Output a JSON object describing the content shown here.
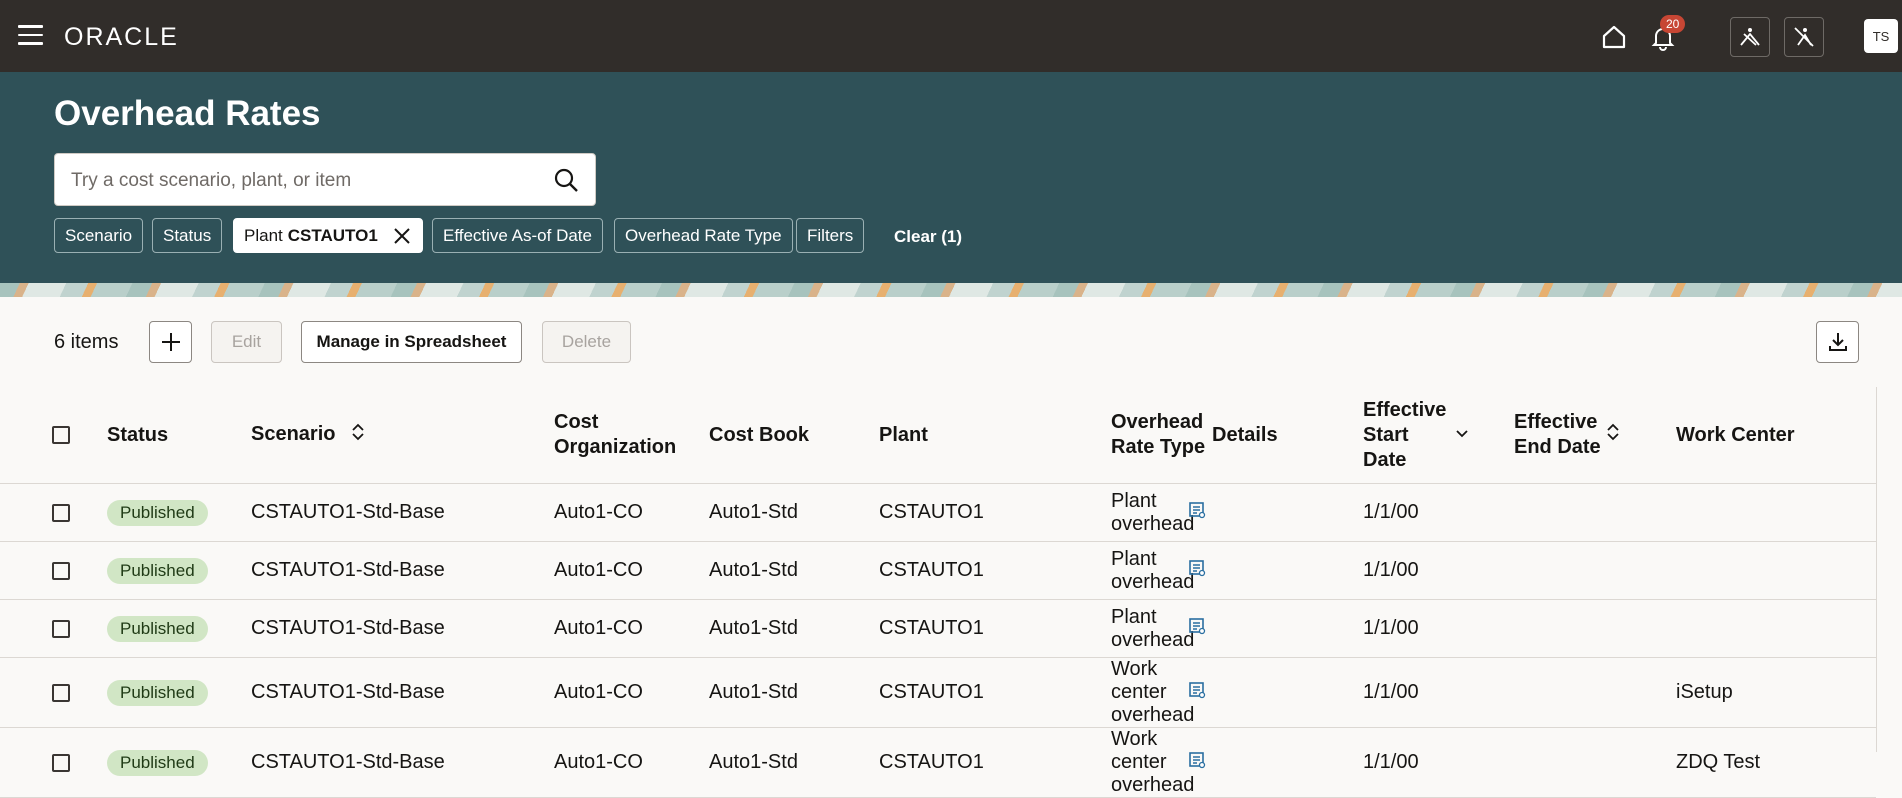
{
  "app": {
    "logo": "ORACLE",
    "notification_count": "20",
    "user_initials": "TS"
  },
  "page": {
    "title": "Overhead Rates"
  },
  "search": {
    "placeholder": "Try a cost scenario, plant, or item"
  },
  "filters": {
    "chips": [
      "Scenario",
      "Status",
      "Effective As-of Date",
      "Overhead Rate Type",
      "Filters"
    ],
    "plant_label": "Plant",
    "plant_value": "CSTAUTO1",
    "clear_label": "Clear (1)"
  },
  "toolbar": {
    "count": "6 items",
    "edit": "Edit",
    "manage": "Manage in Spreadsheet",
    "delete": "Delete"
  },
  "table": {
    "headers": {
      "status": "Status",
      "scenario": "Scenario",
      "cost_org": "Cost Organization",
      "cost_book": "Cost Book",
      "plant": "Plant",
      "rate_type": "Overhead Rate Type",
      "details": "Details",
      "eff_start": "Effective Start Date",
      "eff_end": "Effective End Date",
      "work_center": "Work Center"
    },
    "rows": [
      {
        "status": "Published",
        "scenario": "CSTAUTO1-Std-Base",
        "cost_org": "Auto1-CO",
        "cost_book": "Auto1-Std",
        "plant": "CSTAUTO1",
        "rate_type": "Plant overhead",
        "eff_start": "1/1/00",
        "work_center": ""
      },
      {
        "status": "Published",
        "scenario": "CSTAUTO1-Std-Base",
        "cost_org": "Auto1-CO",
        "cost_book": "Auto1-Std",
        "plant": "CSTAUTO1",
        "rate_type": "Plant overhead",
        "eff_start": "1/1/00",
        "work_center": ""
      },
      {
        "status": "Published",
        "scenario": "CSTAUTO1-Std-Base",
        "cost_org": "Auto1-CO",
        "cost_book": "Auto1-Std",
        "plant": "CSTAUTO1",
        "rate_type": "Plant overhead",
        "eff_start": "1/1/00",
        "work_center": ""
      },
      {
        "status": "Published",
        "scenario": "CSTAUTO1-Std-Base",
        "cost_org": "Auto1-CO",
        "cost_book": "Auto1-Std",
        "plant": "CSTAUTO1",
        "rate_type": "Work center overhead",
        "eff_start": "1/1/00",
        "work_center": "iSetup"
      },
      {
        "status": "Published",
        "scenario": "CSTAUTO1-Std-Base",
        "cost_org": "Auto1-CO",
        "cost_book": "Auto1-Std",
        "plant": "CSTAUTO1",
        "rate_type": "Work center overhead",
        "eff_start": "1/1/00",
        "work_center": "ZDQ Test"
      }
    ]
  }
}
